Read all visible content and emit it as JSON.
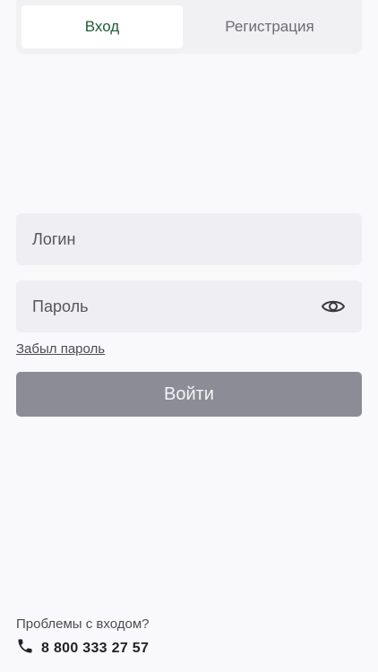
{
  "tabs": {
    "login": "Вход",
    "register": "Регистрация"
  },
  "form": {
    "login_label": "Логин",
    "password_label": "Пароль",
    "forgot_link": "Забыл пароль",
    "submit_label": "Войти"
  },
  "footer": {
    "problems_text": "Проблемы с входом?",
    "phone": "8 800 333 27 57"
  },
  "colors": {
    "active_tab_text": "#1f5b3a",
    "submit_button": "#8b8c95",
    "field_bg": "#efeff3"
  },
  "icons": {
    "password_toggle": "eye-icon",
    "phone": "phone-icon"
  }
}
